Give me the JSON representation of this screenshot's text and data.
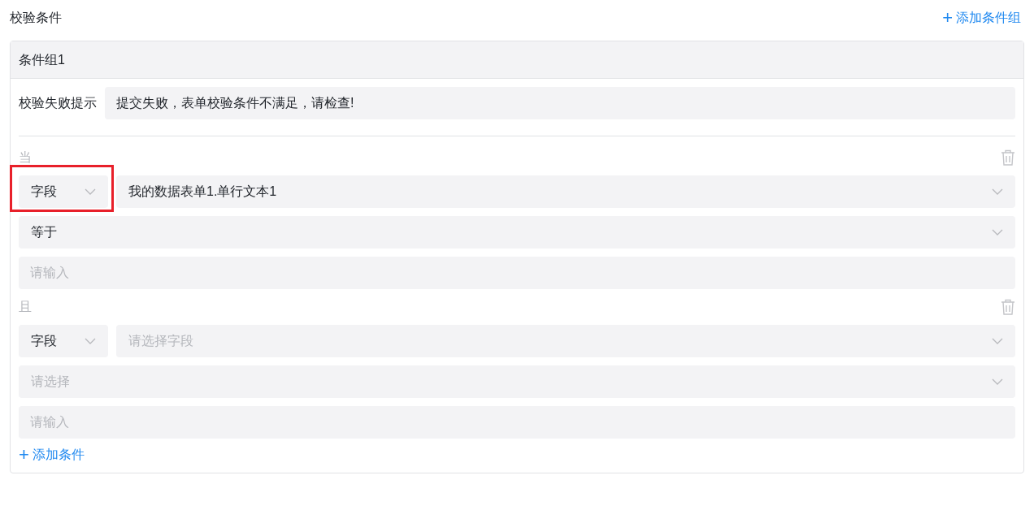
{
  "title": "校验条件",
  "add_group_button": {
    "icon": "+",
    "label": "添加条件组"
  },
  "groups": [
    {
      "title": "条件组1",
      "failure_message": {
        "label": "校验失败提示",
        "value": "提交失败，表单校验条件不满足，请检查!"
      },
      "conditions": [
        {
          "connector": "当",
          "type_select": {
            "value": "字段",
            "highlighted": true
          },
          "field_select": {
            "value": "我的数据表单1.单行文本1"
          },
          "operator_select": {
            "value": "等于"
          },
          "value_input": {
            "placeholder": "请输入"
          }
        },
        {
          "connector": "且",
          "type_select": {
            "value": "字段",
            "highlighted": false
          },
          "field_select": {
            "placeholder": "请选择字段"
          },
          "operator_select": {
            "placeholder": "请选择"
          },
          "value_input": {
            "placeholder": "请输入"
          }
        }
      ],
      "add_condition_button": {
        "icon": "+",
        "label": "添加条件"
      }
    }
  ]
}
